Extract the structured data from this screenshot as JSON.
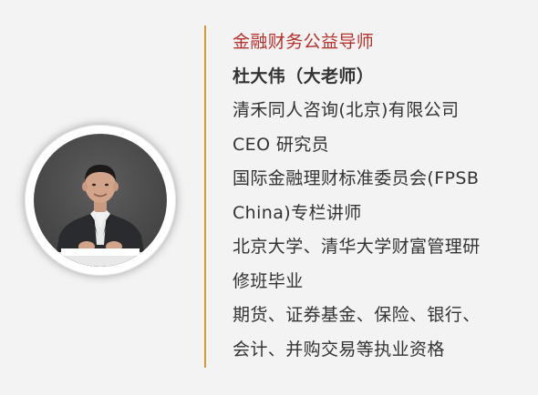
{
  "profile": {
    "heading": "金融财务公益导师",
    "name": "杜大伟（大老师）",
    "lines": [
      "清禾同人咨询(北京)有限公司",
      "CEO 研究员",
      "国际金融理财标准委员会(FPSB",
      "China)专栏讲师",
      "北京大学、清华大学财富管理研",
      "修班毕业",
      "期货、证券基金、保险、银行、",
      "会计、并购交易等执业资格"
    ]
  },
  "colors": {
    "heading": "#b5312d",
    "divider": "#d59a33",
    "text": "#333333",
    "background": "#f3f3f3"
  }
}
